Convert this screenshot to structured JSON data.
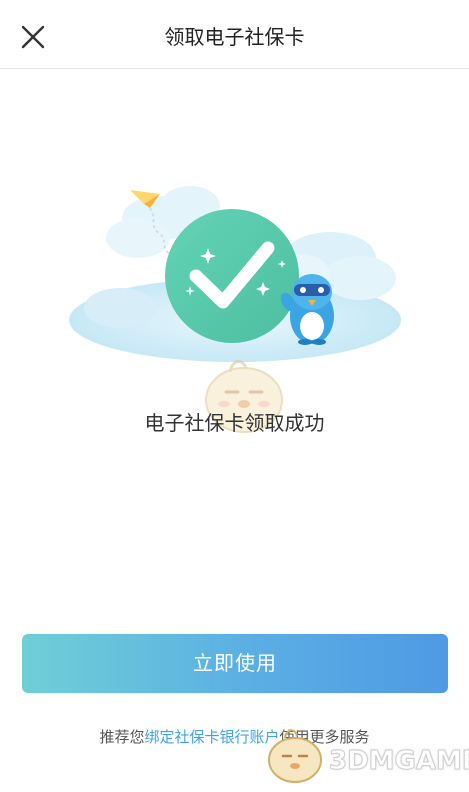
{
  "header": {
    "title": "领取电子社保卡",
    "close_icon": "close-icon"
  },
  "main": {
    "illustration_icon": "success-check-illustration",
    "success_text": "电子社保卡领取成功"
  },
  "actions": {
    "primary_label": "立即使用"
  },
  "footer": {
    "prefix": "推荐您",
    "link_text": "绑定社保卡银行账户",
    "suffix": "使用更多服务"
  },
  "watermark": {
    "text": "3DMGAME"
  },
  "colors": {
    "check_circle": "#5fcfae",
    "button_start": "#6fcfd6",
    "button_end": "#4f9ae4",
    "link": "#3fa3e6",
    "cloud": "#cdebf6"
  }
}
